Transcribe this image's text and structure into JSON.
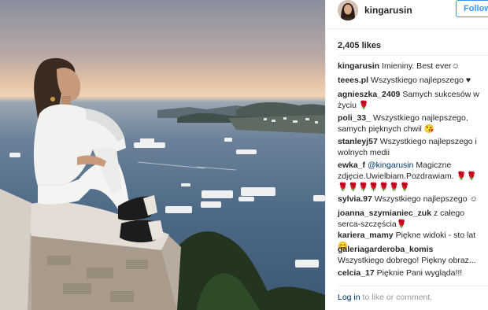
{
  "post": {
    "username": "kingarusin",
    "follow_label": "Follow",
    "likes": "2,405 likes"
  },
  "comments": [
    {
      "user": "kingarusin",
      "text": "Imieniny. Best ever☺"
    },
    {
      "user": "teees.pl",
      "text": "Wszystkiego najlepszego ♥"
    },
    {
      "user": "agnieszka_2409",
      "text": "Samych sukcesów w życiu 🌹"
    },
    {
      "user": "poli_33_",
      "text": "Wszystkiego najlepszego, samych pięknych chwil 😘"
    },
    {
      "user": "stanleyj57",
      "text": "Wszystkiego najlepszego i wolnych medii"
    },
    {
      "user": "ewka_f",
      "mention": "@kingarusin",
      "text": "Magiczne zdjęcie.Uwielbiam.Pozdrawiam. 🌹🌹🌹🌹🌹🌹🌹🌹🌹"
    },
    {
      "user": "sylvia.97",
      "text": "Wszystkiego najlepszego ☺"
    },
    {
      "user": "joanna_szymianiec_zuk",
      "text": "z całego serca-szczęścia🌹"
    },
    {
      "user": "kariera_mamy",
      "text": "Piękne widoki - sto lat 😊"
    },
    {
      "user": "galeriagarderoba_komis",
      "text": "Wszystkiego dobrego! Piękny obraz..."
    },
    {
      "user": "celcia_17",
      "text": "Pięknie Pani wygląda!!!"
    }
  ],
  "footer": {
    "login_label": "Log in",
    "suffix": " to like or comment."
  }
}
